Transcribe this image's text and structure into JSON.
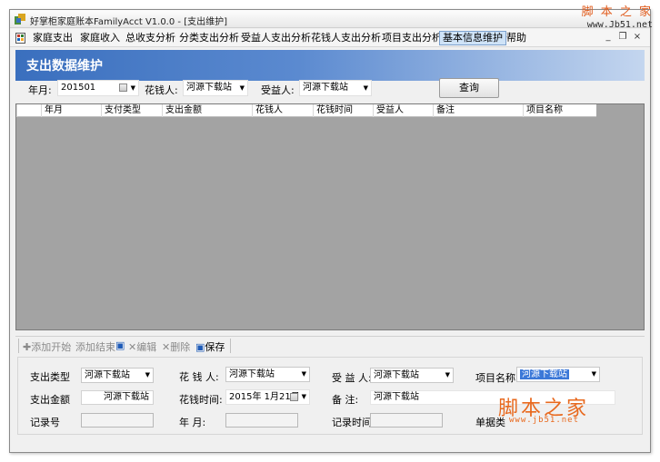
{
  "window": {
    "title": "好掌柜家庭账本FamilyAcct V1.0.0 - [支出维护]",
    "controls": [
      "_",
      "❐",
      "×"
    ]
  },
  "menu": {
    "items": [
      "家庭支出",
      "家庭收入",
      "总收支分析",
      "分类支出分析",
      "受益人支出分析",
      "花钱人支出分析",
      "项目支出分析",
      "基本信息维护",
      "帮助"
    ],
    "active_index": 7
  },
  "banner": {
    "title": "支出数据维护"
  },
  "filter": {
    "year_month_label": "年月:",
    "year_month_value": "201501",
    "spender_label": "花钱人:",
    "spender_value": "河源下载站",
    "beneficiary_label": "受益人:",
    "beneficiary_value": "河源下载站",
    "query_button": "查询"
  },
  "grid": {
    "columns": [
      "年月",
      "支付类型",
      "支出金额",
      "花钱人",
      "花钱时间",
      "受益人",
      "备注",
      "项目名称"
    ]
  },
  "toolbar": {
    "add_start": "添加开始",
    "add_end": "添加结束",
    "edit": "编辑",
    "delete": "删除",
    "save": "保存"
  },
  "form": {
    "pay_type_label": "支出类型",
    "pay_type_value": "河源下载站",
    "spender_label": "花 钱 人:",
    "spender_value": "河源下载站",
    "beneficiary_label": "受 益 人:",
    "beneficiary_value": "河源下载站",
    "project_label": "项目名称:",
    "project_value": "河源下载站",
    "amount_label": "支出金额",
    "amount_value": "河源下载站",
    "spend_time_label": "花钱时间:",
    "spend_time_value": "2015年 1月21日",
    "note_label": "备      注:",
    "note_value": "河源下载站",
    "record_no_label": "记录号",
    "year_month_label": "年      月:",
    "record_time_label": "记录时间:",
    "doc_type_label": "单据类"
  },
  "watermark": {
    "top_text": "脚 本 之 家",
    "top_url": "www.Jb51.net",
    "big_text": "脚本之家",
    "url": "www.jb51.net"
  },
  "colors": {
    "banner_start": "#3a6fbe",
    "grid_bg": "#a3a3a3",
    "selection": "#3b78d8",
    "watermark": "#e8691e"
  }
}
